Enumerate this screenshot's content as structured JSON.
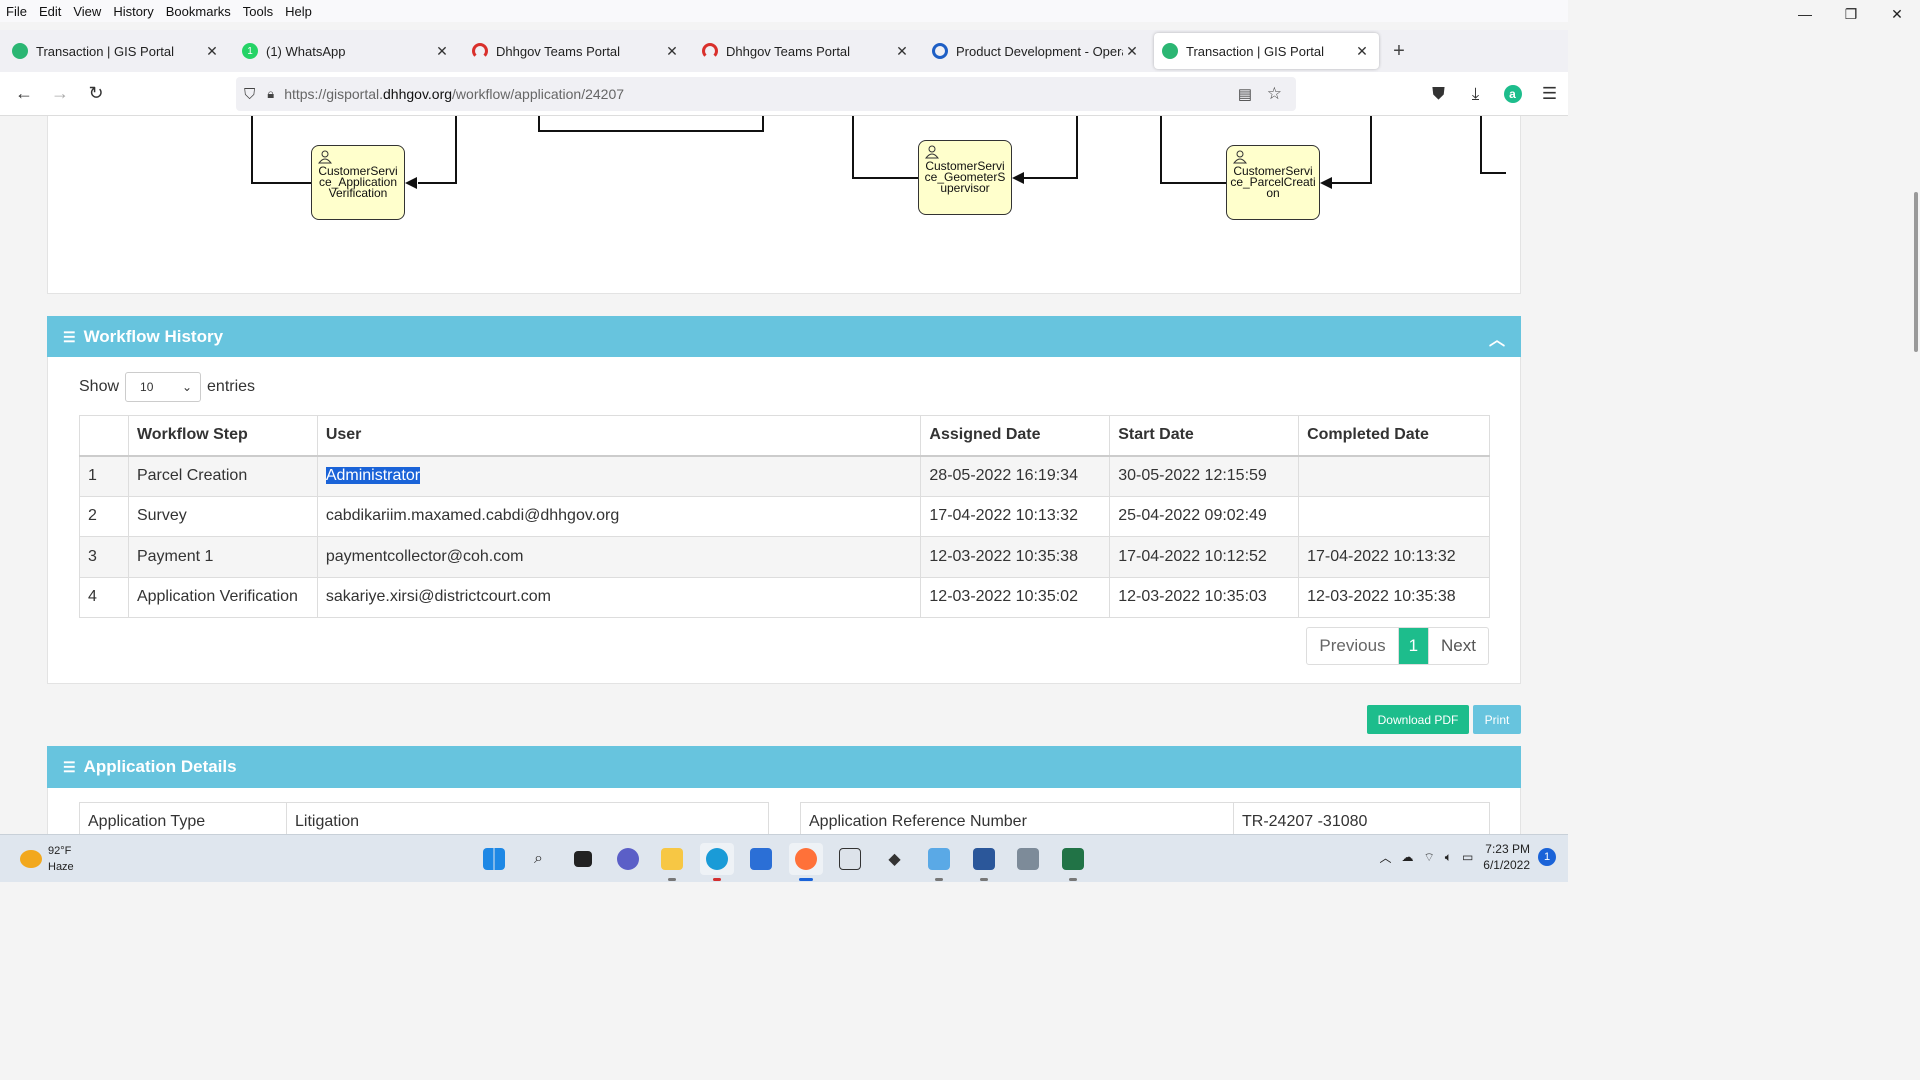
{
  "menu": [
    "File",
    "Edit",
    "View",
    "History",
    "Bookmarks",
    "Tools",
    "Help"
  ],
  "window_controls": {
    "minimize": "—",
    "restore": "❐",
    "close": "✕"
  },
  "tabs": [
    {
      "title": "Transaction | GIS Portal",
      "favicon_color": "#2bb673",
      "active": false
    },
    {
      "title": "(1) WhatsApp",
      "favicon_color": "#25d366",
      "active": false,
      "badge": "1"
    },
    {
      "title": "Dhhgov Teams Portal",
      "favicon_color": "#d9302c",
      "active": false
    },
    {
      "title": "Dhhgov Teams Portal",
      "favicon_color": "#d9302c",
      "active": false
    },
    {
      "title": "Product Development - Operati",
      "favicon_color": "#1e5fc5",
      "active": false
    },
    {
      "title": "Transaction | GIS Portal",
      "favicon_color": "#2bb673",
      "active": true
    }
  ],
  "new_tab": "+",
  "url": {
    "prefix": "https://gisportal.",
    "host": "dhhgov.org",
    "path": "/workflow/application/24207"
  },
  "diagram": {
    "nodes": [
      {
        "label": "CustomerService_ApplicationVerification",
        "lines": [
          "CustomerServi",
          "ce_Application",
          "Verification"
        ]
      },
      {
        "label": "CustomerService_GeometerSupervisor",
        "lines": [
          "CustomerServi",
          "ce_GeometerS",
          "upervisor"
        ]
      },
      {
        "label": "CustomerService_ParcelCreation",
        "lines": [
          "CustomerServi",
          "ce_ParcelCreati",
          "on"
        ]
      }
    ]
  },
  "workflow": {
    "title": "Workflow History",
    "show_label": "Show",
    "entries_label": "entries",
    "page_size": "10",
    "columns": [
      "",
      "Workflow Step",
      "User",
      "Assigned Date",
      "Start Date",
      "Completed Date"
    ],
    "rows": [
      {
        "n": "1",
        "step": "Parcel Creation",
        "user": "Administrator",
        "assigned": "28-05-2022 16:19:34",
        "start": "30-05-2022 12:15:59",
        "completed": ""
      },
      {
        "n": "2",
        "step": "Survey",
        "user": "cabdikariim.maxamed.cabdi@dhhgov.org",
        "assigned": "17-04-2022 10:13:32",
        "start": "25-04-2022 09:02:49",
        "completed": ""
      },
      {
        "n": "3",
        "step": "Payment 1",
        "user": "paymentcollector@coh.com",
        "assigned": "12-03-2022 10:35:38",
        "start": "17-04-2022 10:12:52",
        "completed": "17-04-2022 10:13:32"
      },
      {
        "n": "4",
        "step": "Application Verification",
        "user": "sakariye.xirsi@districtcourt.com",
        "assigned": "12-03-2022 10:35:02",
        "start": "12-03-2022 10:35:03",
        "completed": "12-03-2022 10:35:38"
      }
    ],
    "pager": {
      "previous": "Previous",
      "current": "1",
      "next": "Next"
    }
  },
  "actions": {
    "download_pdf": "Download PDF",
    "print": "Print"
  },
  "details": {
    "title": "Application Details",
    "app_type_label": "Application Type",
    "app_type_value": "Litigation",
    "ref_label": "Application Reference Number",
    "ref_value": "TR-24207 -31080"
  },
  "taskbar": {
    "weather_temp": "92°F",
    "weather_desc": "Haze",
    "time": "7:23 PM",
    "date": "6/1/2022",
    "notifications": "1",
    "apps": [
      "windows-start",
      "search",
      "task-view",
      "teams-chat",
      "file-explorer",
      "edge",
      "microsoft-store",
      "firefox",
      "amazon",
      "dropbox",
      "notepad",
      "word",
      "calculator",
      "excel"
    ]
  },
  "colors": {
    "section_header": "#67c4de",
    "accent_green": "#1dbd8c",
    "print_button": "#67c4de",
    "selection": "#1a63d8"
  }
}
